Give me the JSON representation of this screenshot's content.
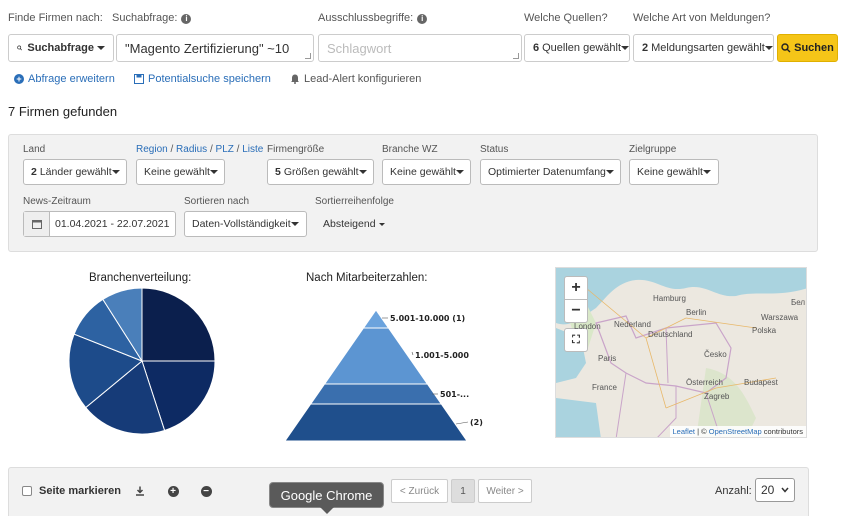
{
  "search": {
    "find_by_label": "Finde Firmen nach:",
    "query_label": "Suchabfrage:",
    "exclude_label": "Ausschlussbegriffe:",
    "sources_label": "Welche Quellen?",
    "types_label": "Welche Art von Meldungen?",
    "mode_value": "Suchabfrage",
    "query_value": "\"Magento Zertifizierung\" ~10",
    "exclude_placeholder": "Schlagwort",
    "sources_count": "6",
    "sources_text": "Quellen gewählt",
    "types_count": "2",
    "types_text": "Meldungsarten gewählt",
    "search_button": "Suchen"
  },
  "actions": {
    "expand_query": "Abfrage erweitern",
    "save_search": "Potentialsuche speichern",
    "lead_alert": "Lead-Alert konfigurieren"
  },
  "results_title": "7 Firmen gefunden",
  "filters": {
    "land_label": "Land",
    "land_count": "2",
    "land_text": "Länder gewählt",
    "region_link": "Region",
    "radius_link": "Radius",
    "plz_link": "PLZ",
    "liste_link": "Liste",
    "sep": "/",
    "region_value": "Keine gewählt",
    "size_label": "Firmengröße",
    "size_count": "5",
    "size_text": "Größen gewählt",
    "branch_label": "Branche WZ",
    "branch_value": "Keine gewählt",
    "status_label": "Status",
    "status_value": "Optimierter Datenumfang",
    "target_label": "Zielgruppe",
    "target_value": "Keine gewählt",
    "news_label": "News-Zeitraum",
    "news_value": "01.04.2021 - 22.07.2021",
    "sort_label": "Sortieren nach",
    "sort_value": "Daten-Vollständigkeit",
    "order_label": "Sortierreihenfolge",
    "order_value": "Absteigend"
  },
  "chart_data": [
    {
      "type": "pie",
      "title": "Branchenverteilung:",
      "values": [
        25,
        20,
        19,
        17,
        10,
        9
      ],
      "colors": [
        "#0b1f4d",
        "#0d2a63",
        "#163b78",
        "#1d4b8a",
        "#2d62a2",
        "#4a7fba"
      ]
    },
    {
      "type": "bar",
      "title": "Nach Mitarbeiterzahlen:",
      "categories": [
        "5.001-10.000",
        "1.001-5.000",
        "501-...",
        ""
      ],
      "values": [
        1,
        2,
        1,
        2
      ],
      "labels": [
        "5.001-10.000 (1)",
        "1.001-5.000",
        "501-...",
        "(2)"
      ],
      "colors": [
        "#6ba3dd",
        "#5c95d2",
        "#3a6fae",
        "#1f4f8c"
      ]
    }
  ],
  "map": {
    "zoom_in": "+",
    "zoom_out": "−",
    "places": [
      "Hamburg",
      "Berlin",
      "Warszawa",
      "Nederland",
      "London",
      "Deutschland",
      "Paris",
      "Česko",
      "France",
      "Österreich",
      "Budapest",
      "Zagreb",
      "Polska",
      "Бел"
    ],
    "attribution_leaflet": "Leaflet",
    "attribution_sep": " | © ",
    "attribution_osm": "OpenStreetMap",
    "attribution_tail": " contributors"
  },
  "bottom": {
    "select_page": "Seite markieren",
    "prev": "< Zurück",
    "page": "1",
    "next": "Weiter >",
    "count_label": "Anzahl:",
    "count_value": "20",
    "tooltip": "Google Chrome"
  }
}
